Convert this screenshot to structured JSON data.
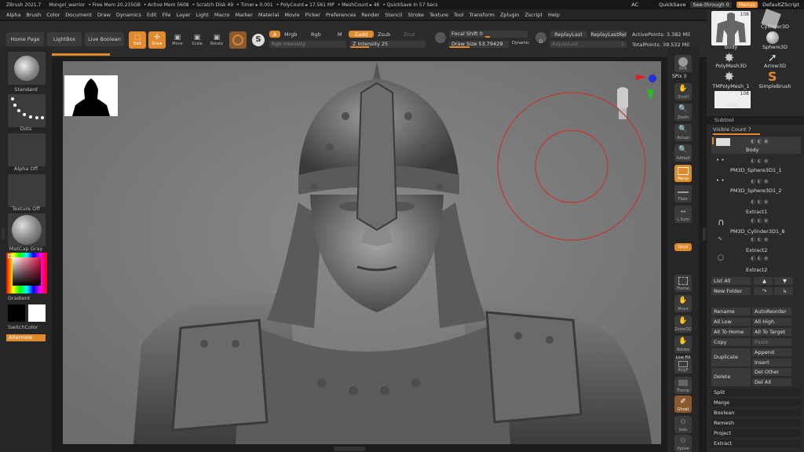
{
  "titlebar": {
    "app": "ZBrush 2021.7",
    "doc": "Mongol_warrior",
    "stats": [
      "• Free Mem 20.235GB",
      "• Active Mem 5608",
      "• Scratch Disk 49",
      "• Timer ▸ 0.001",
      "• PolyCount ▸ 17.561 MP",
      "• MeshCount ▸ 46",
      "• QuickSave In 57 Secs"
    ],
    "ac": "AC",
    "quicksave": "QuickSave",
    "seethrough": "See-through  0",
    "menus": "Menus",
    "script": "DefaultZScript"
  },
  "menubar": [
    "Alpha",
    "Brush",
    "Color",
    "Document",
    "Draw",
    "Dynamics",
    "Edit",
    "File",
    "Layer",
    "Light",
    "Macro",
    "Marker",
    "Material",
    "Movie",
    "Picker",
    "Preferences",
    "Render",
    "Stencil",
    "Stroke",
    "Texture",
    "Tool",
    "Transform",
    "Zplugin",
    "Zscript",
    "Help"
  ],
  "toolbar": {
    "home": "Home Page",
    "lightbox": "LightBox",
    "liveboolean": "Live Boolean",
    "edit": "Edit",
    "draw": "Draw",
    "move": "Move",
    "scale": "Scale",
    "rotate": "Rotate",
    "a": "A",
    "mrgb": "Mrgb",
    "rgb": "Rgb",
    "m": "M",
    "zadd": "Zadd",
    "zsub": "Zsub",
    "zcut": "Zcut",
    "rgb_intensity": "Rgb Intensity",
    "z_intensity": "Z Intensity 25",
    "z_intensity_value": 0.25,
    "focal_shift": "Focal Shift 0",
    "draw_size": "Draw Size 53.79429",
    "dynamic": "Dynamic",
    "d": "D",
    "replaylast": "ReplayLast",
    "replaylastrel": "ReplayLastRel",
    "adjustlast": "AdjustLast",
    "adjustlast_val": "1",
    "active_points": "ActivePoints: 3.382 Mil",
    "total_points": "TotalPoints: 39.532 Mil"
  },
  "leftshelf": {
    "brush": "Standard",
    "stroke": "Dots",
    "alpha": "Alpha Off",
    "texture": "Texture Off",
    "material": "MatCap Gray",
    "gradient": "Gradient",
    "switchcolor": "SwitchColor",
    "alternate": "Alternate"
  },
  "rightshelf": [
    "BPR",
    "SPix 3",
    "Scroll",
    "Zoom",
    "Actual",
    "AAHalf",
    "Persp",
    "Floor",
    "L.Sym",
    "Qxyz",
    "Frame",
    "Move",
    "Zoom3D",
    "Rotate",
    "Line Fill",
    "PolyF",
    "Transp",
    "Ghost",
    "Solo",
    "Xpose"
  ],
  "toolpanel": {
    "count1": "108",
    "count2": "108",
    "items": [
      "Body",
      "Cylinder3D",
      "Sphere3D",
      "PolyMesh3D",
      "Arrow3D",
      "TMPolyMesh_1",
      "SimpleBrush",
      "Body"
    ],
    "subtool": "Subtool",
    "visible_count": "Visible Count 7",
    "subtools": [
      "Body",
      "PM3D_Sphere3D1_1",
      "PM3D_Sphere3D1_2",
      "Extract1",
      "PM3D_Cylinder3D1_8",
      "Extract2",
      "Extract2"
    ],
    "buttons": {
      "list_all": "List All",
      "new_folder": "New Folder",
      "rename": "Rename",
      "autoreorder": "AutoReorder",
      "all_low": "All Low",
      "all_high": "All High",
      "all_to_home": "All To Home",
      "all_to_target": "All To Target",
      "copy": "Copy",
      "paste": "Paste",
      "duplicate": "Duplicate",
      "append": "Append",
      "insert": "Insert",
      "delete": "Delete",
      "del_other": "Del Other",
      "del_all": "Del All",
      "split": "Split",
      "merge": "Merge",
      "boolean": "Boolean",
      "remesh": "Remesh",
      "project": "Project",
      "extract": "Extract"
    }
  },
  "colors": {
    "accent": "#e08a2e",
    "bg": "#1d1d1d",
    "viewport": "#777777",
    "brush_circle": "#c0392b"
  }
}
